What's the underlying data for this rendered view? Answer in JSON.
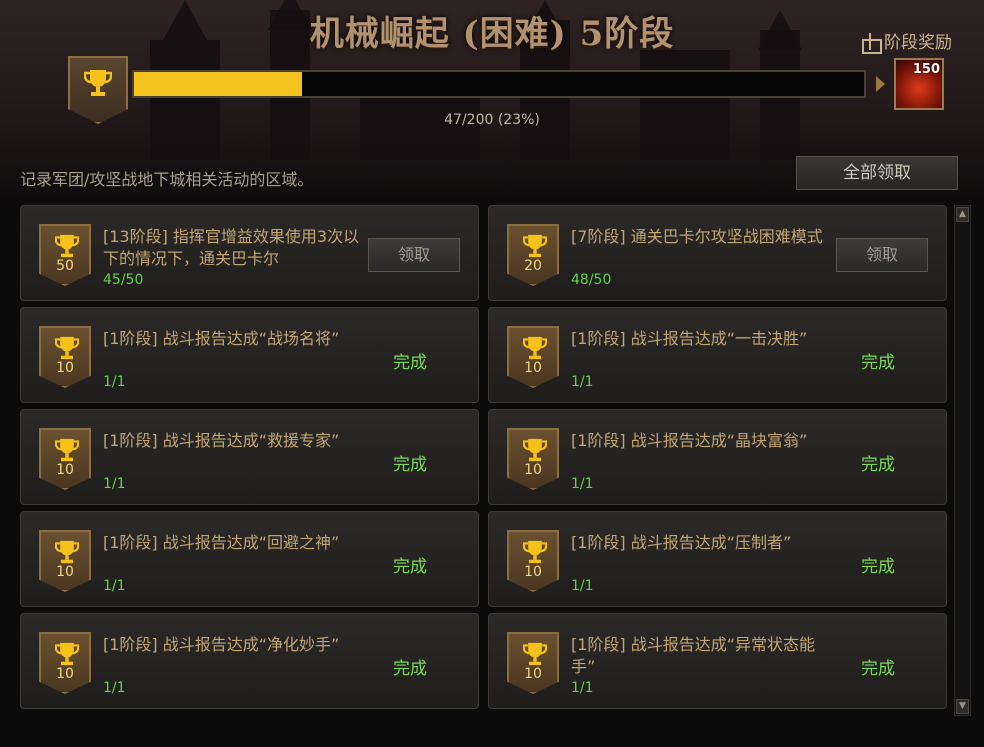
{
  "header": {
    "title": "机械崛起 (困难) 5阶段",
    "stage_reward_label": "阶段奖励",
    "progress_text": "47/200 (23%)",
    "progress_fraction": 0.23,
    "reward_quantity": "150"
  },
  "description": "记录军团/攻坚战地下城相关活动的区域。",
  "claim_all_label": "全部领取",
  "missions": [
    {
      "title": "[13阶段] 指挥官增益效果使用3次以下的情况下，通关巴卡尔",
      "points": "50",
      "progress": "45/50",
      "action": "领取",
      "state": "claim"
    },
    {
      "title": "[7阶段] 通关巴卡尔攻坚战困难模式",
      "points": "20",
      "progress": "48/50",
      "action": "领取",
      "state": "claim"
    },
    {
      "title": "[1阶段] 战斗报告达成“战场名将”",
      "points": "10",
      "progress": "1/1",
      "action": "完成",
      "state": "done"
    },
    {
      "title": "[1阶段] 战斗报告达成“一击决胜”",
      "points": "10",
      "progress": "1/1",
      "action": "完成",
      "state": "done"
    },
    {
      "title": "[1阶段] 战斗报告达成“救援专家”",
      "points": "10",
      "progress": "1/1",
      "action": "完成",
      "state": "done"
    },
    {
      "title": "[1阶段] 战斗报告达成“晶块富翁”",
      "points": "10",
      "progress": "1/1",
      "action": "完成",
      "state": "done"
    },
    {
      "title": "[1阶段] 战斗报告达成“回避之神”",
      "points": "10",
      "progress": "1/1",
      "action": "完成",
      "state": "done"
    },
    {
      "title": "[1阶段] 战斗报告达成“压制者”",
      "points": "10",
      "progress": "1/1",
      "action": "完成",
      "state": "done"
    },
    {
      "title": "[1阶段] 战斗报告达成“净化妙手”",
      "points": "10",
      "progress": "1/1",
      "action": "完成",
      "state": "done"
    },
    {
      "title": "[1阶段] 战斗报告达成“异常状态能手”",
      "points": "10",
      "progress": "1/1",
      "action": "完成",
      "state": "done"
    }
  ],
  "colors": {
    "progress_fill": "#f4c320",
    "done_text": "#7bd85a",
    "progress_text": "#64d04a",
    "title_text": "#c2a572"
  },
  "icons": {
    "trophy": "trophy-icon",
    "gift": "gift-icon",
    "scroll_up": "chevron-up-icon",
    "scroll_down": "chevron-down-icon"
  }
}
